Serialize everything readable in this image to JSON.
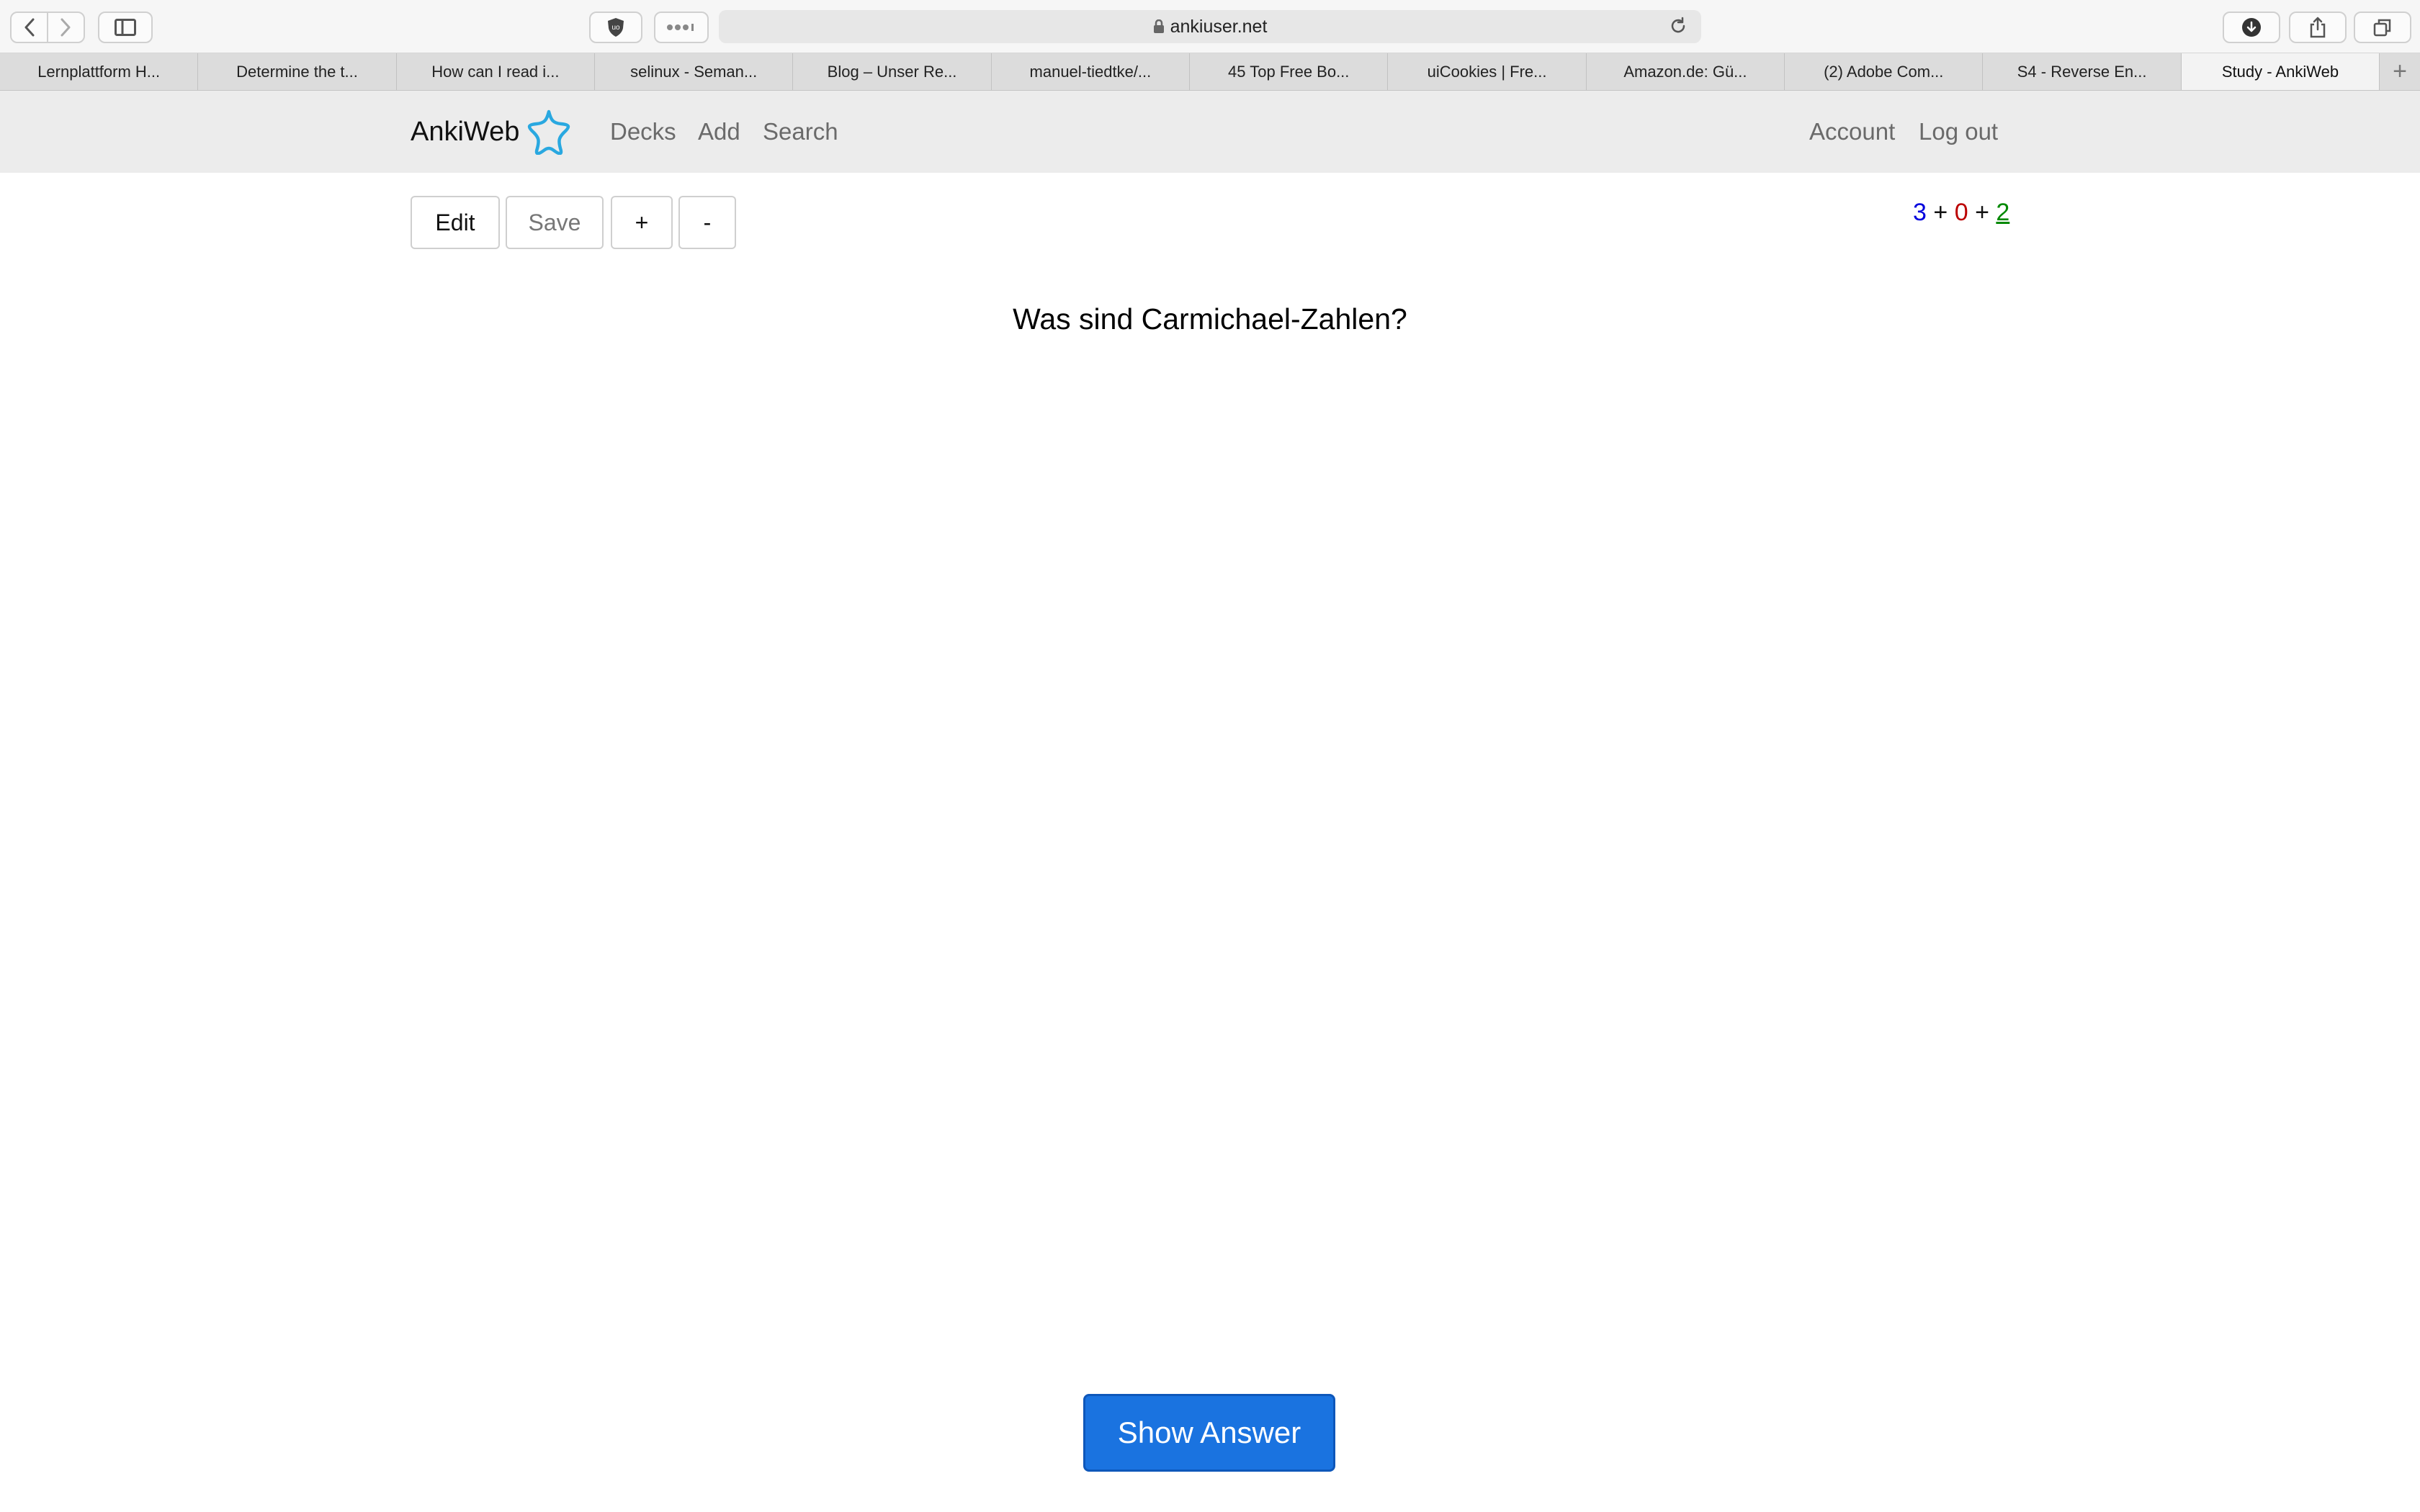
{
  "browser": {
    "url": "ankiuser.net",
    "tabs": [
      {
        "label": "Lernplattform H..."
      },
      {
        "label": "Determine the t..."
      },
      {
        "label": "How can I read i..."
      },
      {
        "label": "selinux - Seman..."
      },
      {
        "label": "Blog – Unser Re..."
      },
      {
        "label": "manuel-tiedtke/..."
      },
      {
        "label": "45 Top Free Bo..."
      },
      {
        "label": "uiCookies | Fre..."
      },
      {
        "label": "Amazon.de: Gü..."
      },
      {
        "label": "(2) Adobe Com..."
      },
      {
        "label": "S4 - Reverse En..."
      },
      {
        "label": "Study - AnkiWeb"
      }
    ],
    "new_tab_label": "+"
  },
  "navbar": {
    "brand": "AnkiWeb",
    "links": {
      "decks": "Decks",
      "add": "Add",
      "search": "Search",
      "account": "Account",
      "logout": "Log out"
    }
  },
  "study": {
    "buttons": {
      "edit": "Edit",
      "save": "Save",
      "plus": "+",
      "minus": "-"
    },
    "counts": {
      "new": "3",
      "learning": "0",
      "review": "2",
      "separator": "+"
    },
    "question": "Was sind Carmichael-Zahlen?",
    "show_answer": "Show Answer"
  },
  "colors": {
    "accent": "#1a73e0",
    "new_count": "#0000dd",
    "learning_count": "#bb0000",
    "review_count": "#008800",
    "brand_star": "#29a8e0"
  }
}
